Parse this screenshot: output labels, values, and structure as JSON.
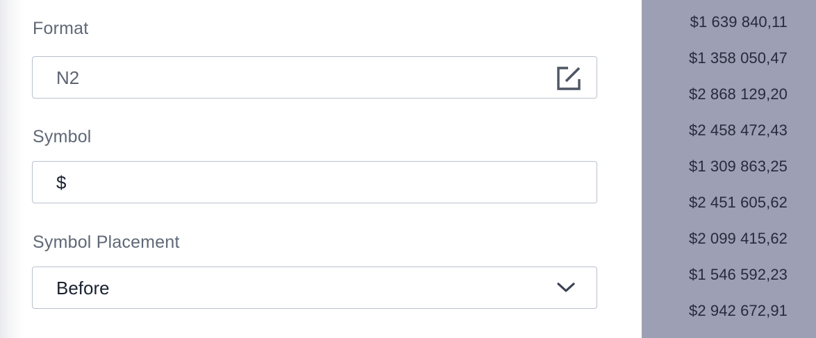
{
  "form": {
    "format": {
      "label": "Format",
      "value": "N2",
      "icon": "edit-icon"
    },
    "symbol": {
      "label": "Symbol",
      "value": "$"
    },
    "symbol_placement": {
      "label": "Symbol Placement",
      "selected": "Before",
      "icon": "chevron-down-icon"
    }
  },
  "preview": {
    "values": [
      "$1 639 840,11",
      "$1 358 050,47",
      "$2 868 129,20",
      "$2 458 472,43",
      "$1 309 863,25",
      "$2 451 605,62",
      "$2 099 415,62",
      "$1 546 592,23",
      "$2 942 672,91"
    ]
  },
  "colors": {
    "preview_background": "#9d9fb4",
    "field_border": "#b9c0cc",
    "label_text": "#5f6876"
  }
}
